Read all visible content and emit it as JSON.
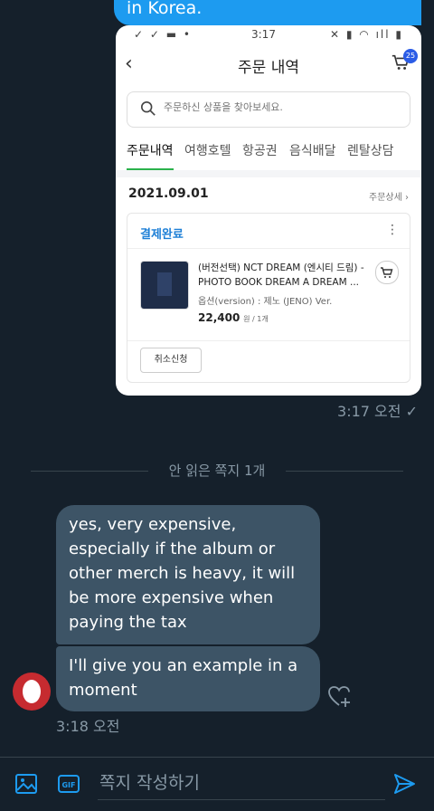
{
  "chat": {
    "top_message_partial": "in Korea.",
    "sent_time": "3:17 오전",
    "unread_divider": "안 읽은 쪽지 1개",
    "received": [
      "yes, very expensive, especially if the album or other merch is heavy, it will be more expensive when paying the tax",
      "I'll give you an example in a moment"
    ],
    "received_time": "3:18 오전"
  },
  "screenshot": {
    "status_time": "3:17",
    "title": "주문 내역",
    "cart_badge": "25",
    "search_placeholder": "주문하신 상품을 찾아보세요.",
    "tabs": [
      "주문내역",
      "여행호텔",
      "항공권",
      "음식배달",
      "렌탈상담"
    ],
    "order_date": "2021.09.01",
    "order_detail_link": "주문상세 ›",
    "status": "결제완료",
    "product_name": "(버전선택) NCT DREAM (엔시티 드림) - PHOTO BOOK DREAM A DREAM ...",
    "option": "옵션(version) : 제노 (JENO) Ver.",
    "price": "22,400",
    "price_unit": "원 / 1개",
    "cancel_button": "취소신청"
  },
  "composer": {
    "placeholder": "쪽지 작성하기"
  },
  "icons": {
    "image": "image-icon",
    "gif": "gif-icon",
    "send": "send-icon",
    "heart": "heart-plus-icon"
  },
  "colors": {
    "background": "#15202b",
    "accent": "#1d9bf0",
    "received_bubble": "#3d5466",
    "muted": "#8899a6"
  }
}
